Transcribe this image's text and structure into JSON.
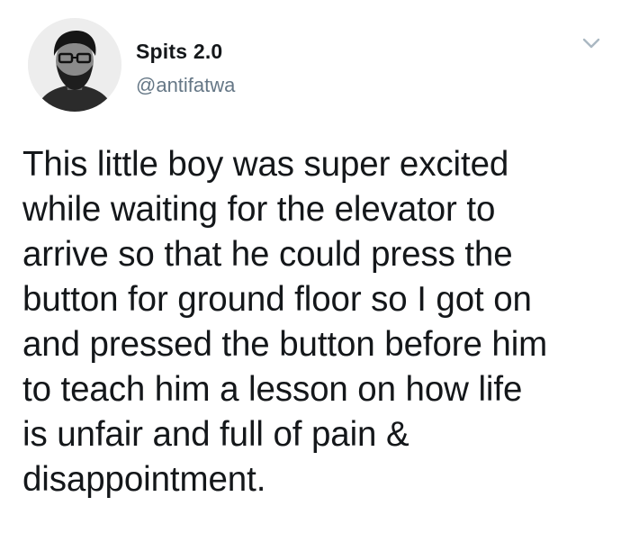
{
  "tweet": {
    "author": {
      "display_name": "Spits 2.0",
      "handle": "@antifatwa",
      "avatar_icon": "user-avatar"
    },
    "menu_icon": "chevron-down-icon",
    "text": "This little boy was super excited\nwhile waiting for the elevator to\narrive so that he could press the\nbutton for ground floor so I got on\nand pressed the button before him\nto teach him a lesson on how life\nis unfair and full of pain &\ndisappointment.",
    "colors": {
      "text": "#14171a",
      "secondary": "#657786",
      "chevron": "#aab8c2"
    }
  }
}
